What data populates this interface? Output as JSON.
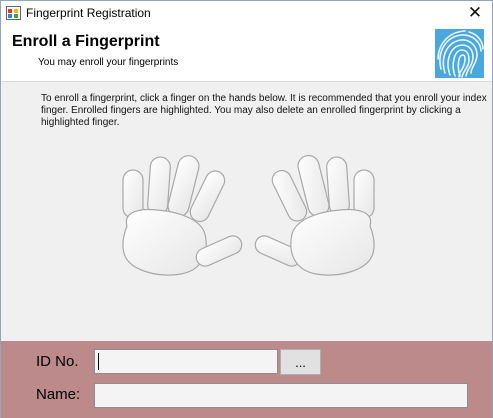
{
  "window": {
    "title": "Fingerprint Registration",
    "close_glyph": "✕"
  },
  "header": {
    "title": "Enroll a Fingerprint",
    "subtitle": "You may enroll your fingerprints",
    "logo_icon": "fingerprint-icon"
  },
  "instructions": "To enroll a fingerprint, click a finger on the hands below. It is recommended that you enroll your index finger. Enrolled fingers are highlighted. You may also delete an enrolled fingerprint by clicking a highlighted finger.",
  "hands": {
    "left_fingers": [
      "left-pinky",
      "left-ring",
      "left-middle",
      "left-index",
      "left-thumb"
    ],
    "right_fingers": [
      "right-thumb",
      "right-index",
      "right-middle",
      "right-ring",
      "right-pinky"
    ],
    "enrolled": []
  },
  "form": {
    "id_label": "ID No.",
    "id_value": "",
    "browse_label": "...",
    "name_label": "Name:",
    "name_value": ""
  },
  "colors": {
    "footer_bg": "#bc8a8a",
    "content_bg": "#f0f0f0",
    "logo_blue": "#2e9ad6"
  }
}
